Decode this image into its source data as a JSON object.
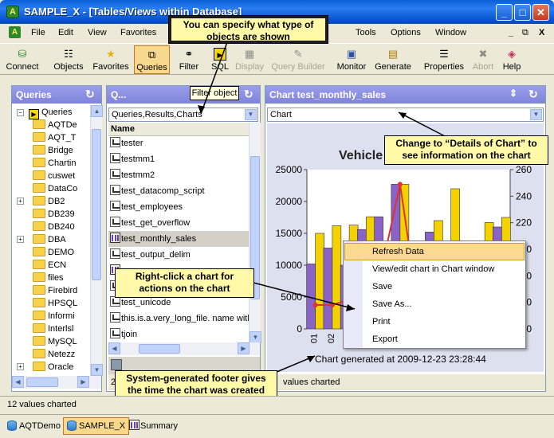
{
  "window": {
    "title": "SAMPLE_X - [Tables/Views within Database]",
    "app_icon": "aqt-app-icon"
  },
  "menu": [
    "File",
    "Edit",
    "View",
    "Favorites",
    "C",
    "Tools",
    "Options",
    "Window"
  ],
  "menu_right": [
    "_",
    "⧉",
    "X"
  ],
  "toolbar": [
    {
      "label": "Connect",
      "icon": "connect-icon",
      "state": "normal"
    },
    {
      "label": "Objects",
      "icon": "objects-icon",
      "state": "normal"
    },
    {
      "label": "Favorites",
      "icon": "star-icon",
      "state": "normal"
    },
    {
      "label": "Queries",
      "icon": "queries-icon",
      "state": "active"
    },
    {
      "label": "Filter",
      "icon": "binoculars-icon",
      "state": "normal"
    },
    {
      "label": "SQL",
      "icon": "sql-icon",
      "state": "normal"
    },
    {
      "label": "Display",
      "icon": "display-icon",
      "state": "disabled"
    },
    {
      "label": "Query Builder",
      "icon": "query-builder-icon",
      "state": "disabled"
    },
    {
      "label": "Monitor",
      "icon": "monitor-icon",
      "state": "normal"
    },
    {
      "label": "Generate",
      "icon": "generate-icon",
      "state": "normal"
    },
    {
      "label": "Properties",
      "icon": "properties-icon",
      "state": "normal"
    },
    {
      "label": "Abort",
      "icon": "abort-icon",
      "state": "disabled"
    },
    {
      "label": "Help",
      "icon": "help-icon",
      "state": "normal"
    }
  ],
  "left_panel": {
    "title": "Queries",
    "tree": [
      {
        "label": "Queries",
        "type": "root"
      },
      {
        "label": "AQTDe",
        "type": "folder"
      },
      {
        "label": "AQT_T",
        "type": "folder"
      },
      {
        "label": "Bridge",
        "type": "folder"
      },
      {
        "label": "Chartin",
        "type": "folder"
      },
      {
        "label": "cuswet",
        "type": "folder"
      },
      {
        "label": "DataCo",
        "type": "folder"
      },
      {
        "label": "DB2",
        "type": "folder",
        "expandable": true
      },
      {
        "label": "DB239",
        "type": "folder"
      },
      {
        "label": "DB240",
        "type": "folder"
      },
      {
        "label": "DBA",
        "type": "folder",
        "expandable": true
      },
      {
        "label": "DEMO",
        "type": "folder"
      },
      {
        "label": "ECN",
        "type": "folder"
      },
      {
        "label": "files",
        "type": "folder"
      },
      {
        "label": "Firebird",
        "type": "folder"
      },
      {
        "label": "HPSQL",
        "type": "folder"
      },
      {
        "label": "Informi",
        "type": "folder"
      },
      {
        "label": "Interlsl",
        "type": "folder"
      },
      {
        "label": "MySQL",
        "type": "folder"
      },
      {
        "label": "Netezz",
        "type": "folder"
      },
      {
        "label": "Oracle",
        "type": "folder",
        "expandable": true
      }
    ]
  },
  "mid_panel": {
    "title": "Q...",
    "tooltip": "Filter object",
    "filter_value": "Queries,Results,Charts",
    "column_header": "Name",
    "items": [
      {
        "label": "tester",
        "type": "result"
      },
      {
        "label": "testmm1",
        "type": "result"
      },
      {
        "label": "testmm2",
        "type": "result"
      },
      {
        "label": "test_datacomp_script",
        "type": "result"
      },
      {
        "label": "test_employees",
        "type": "result"
      },
      {
        "label": "test_get_overflow",
        "type": "result"
      },
      {
        "label": "test_monthly_sales",
        "type": "chart",
        "selected": true
      },
      {
        "label": "test_output_delim",
        "type": "result"
      },
      {
        "label": "",
        "type": "chart"
      },
      {
        "label": "",
        "type": "result"
      },
      {
        "label": "test_unicode",
        "type": "result"
      },
      {
        "label": "this.is.a.very_long_file. name with",
        "type": "result"
      },
      {
        "label": "tjoin",
        "type": "result"
      }
    ],
    "footer_partial": "2"
  },
  "chart_panel": {
    "title": "Chart test_monthly_sales",
    "view_select": "Chart",
    "footer_text": "Chart generated at 2009-12-23 23:28:44"
  },
  "chart_data": {
    "type": "bar",
    "title": "Vehicle",
    "categories": [
      "01",
      "02",
      "03",
      "04",
      "05",
      "06",
      "07",
      "08",
      "09",
      "10",
      "11",
      "12"
    ],
    "series": [
      {
        "type": "bar",
        "values": [
          10200,
          12700,
          10000,
          15600,
          17600,
          22700,
          10500,
          15200,
          13000,
          9500,
          12600,
          16000
        ],
        "color": "#8a63c8"
      },
      {
        "type": "bar",
        "values": [
          15000,
          16200,
          16300,
          17600,
          10000,
          22700,
          12000,
          17000,
          22000,
          9600,
          16700,
          17500
        ],
        "color": "#f3d200"
      },
      {
        "type": "line",
        "values": [
          158,
          158,
          162,
          186,
          190,
          249,
          162,
          null,
          null,
          null,
          null,
          null
        ],
        "color": "#e03030"
      }
    ],
    "ylim_left": [
      0,
      25000
    ],
    "yticks_left": [
      "25000",
      "20000",
      "15000",
      "10000",
      "5000",
      "0"
    ],
    "ylim_right": [
      140,
      260
    ],
    "yticks_right": [
      "260",
      "240",
      "220",
      "200",
      "180",
      "160",
      "140"
    ]
  },
  "context_menu": [
    {
      "label": "Refresh Data",
      "highlighted": true
    },
    {
      "label": "View/edit chart in Chart window"
    },
    {
      "label": "Save"
    },
    {
      "label": "Save As..."
    },
    {
      "label": "Print"
    },
    {
      "label": "Export"
    }
  ],
  "callouts": {
    "top": "You can specify what type of objects are shown",
    "right": "Change to “Details of Chart” to see information on the chart",
    "mid": "Right-click a chart for actions on the chart",
    "bottom": "System-generated footer gives the time the chart was created"
  },
  "statusbar": {
    "left_text": "12 values charted",
    "mid_text": "values charted"
  },
  "tabs": [
    {
      "label": "AQTDemo",
      "icon": "database-icon"
    },
    {
      "label": "SAMPLE_X",
      "icon": "database-icon",
      "active": true
    },
    {
      "label": "Summary",
      "icon": "chart-icon"
    }
  ]
}
